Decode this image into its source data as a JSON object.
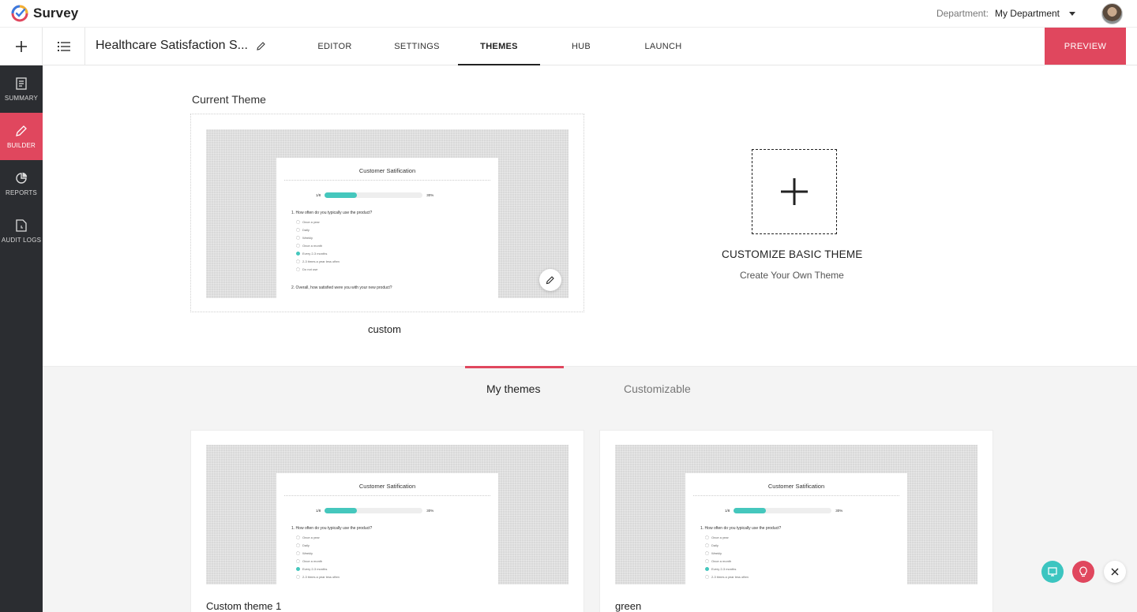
{
  "app": {
    "name": "Survey"
  },
  "header": {
    "department_label": "Department:",
    "department_value": "My Department"
  },
  "survey": {
    "title": "Healthcare Satisfaction S..."
  },
  "tabs": [
    {
      "label": "EDITOR"
    },
    {
      "label": "SETTINGS"
    },
    {
      "label": "THEMES",
      "active": true
    },
    {
      "label": "HUB"
    },
    {
      "label": "LAUNCH"
    }
  ],
  "preview_label": "PREVIEW",
  "sidebar": {
    "items": [
      {
        "label": "SUMMARY",
        "icon": "document-icon"
      },
      {
        "label": "BUILDER",
        "icon": "pencil-icon",
        "active": true
      },
      {
        "label": "REPORTS",
        "icon": "pie-chart-icon"
      },
      {
        "label": "AUDIT LOGS",
        "icon": "file-clock-icon"
      }
    ]
  },
  "current_theme": {
    "label": "Current Theme",
    "name": "custom"
  },
  "preview_sample": {
    "title": "Customer Satification",
    "progress_text": "1/8",
    "progress_percent": "30%",
    "progress_fraction": 0.33,
    "q1": "1. How often do you typically use the product?",
    "options": [
      "Once a year",
      "Daily",
      "Weekly",
      "Once a month",
      "Every 2-3 months",
      "2-3 times a year less often",
      "Do not use"
    ],
    "q2": "2. Overall, how satisfied were you with your new product?"
  },
  "customize": {
    "title": "CUSTOMIZE BASIC THEME",
    "subtitle": "Create Your Own Theme"
  },
  "lower_tabs": [
    {
      "label": "My themes",
      "active": true
    },
    {
      "label": "Customizable"
    }
  ],
  "themes": [
    {
      "name": "Custom theme 1"
    },
    {
      "name": "green"
    }
  ],
  "colors": {
    "accent": "#e0475e",
    "teal": "#45c7bd",
    "sidebar": "#2b2d31"
  }
}
